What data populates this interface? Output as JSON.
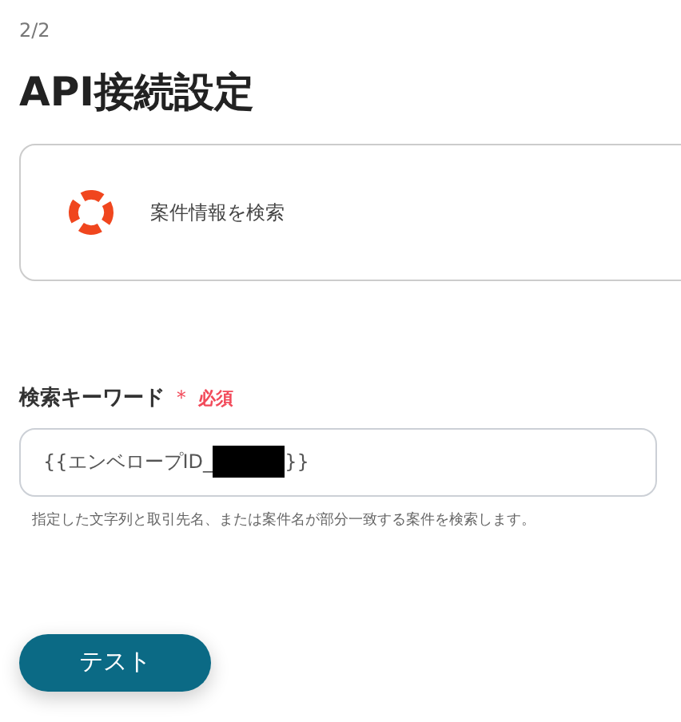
{
  "step": "2/2",
  "title": "API接続設定",
  "action_card": {
    "label": "案件情報を検索"
  },
  "field": {
    "label": "検索キーワード",
    "required_mark": "＊",
    "required_text": "必須",
    "value_before": "{{エンベロープID_",
    "redacted": true,
    "value_after": "}}",
    "hint": "指定した文字列と取引先名、または案件名が部分一致する案件を検索します。"
  },
  "button": {
    "label": "テスト"
  }
}
